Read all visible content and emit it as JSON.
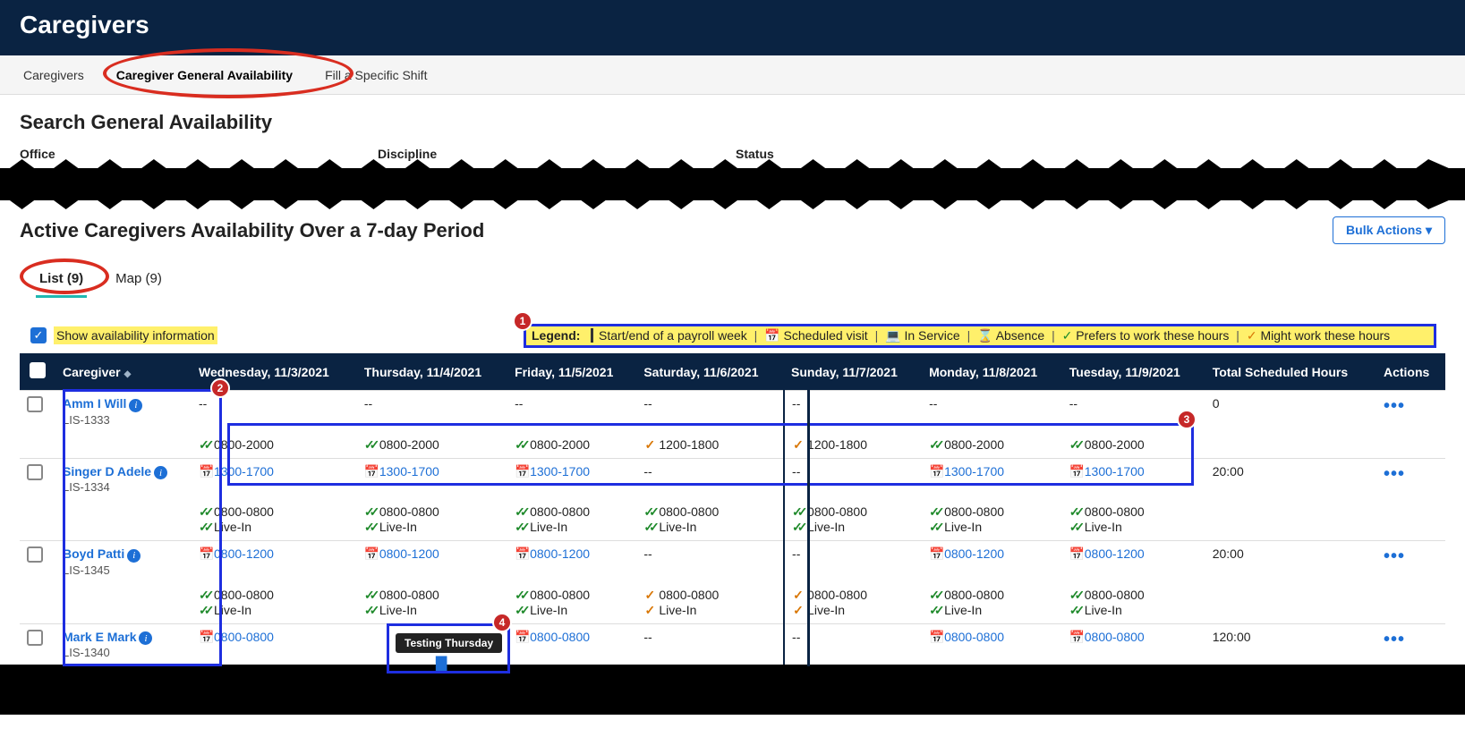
{
  "header": {
    "title": "Caregivers"
  },
  "tabs": {
    "items": [
      "Caregivers",
      "Caregiver General Availability",
      "Fill a Specific Shift"
    ],
    "active_index": 1
  },
  "search": {
    "heading": "Search General Availability",
    "filters": [
      "Office",
      "Discipline",
      "Status"
    ]
  },
  "results": {
    "heading": "Active Caregivers Availability Over a 7-day Period",
    "bulk_label": "Bulk Actions ▾",
    "sub_tabs": {
      "list": "List (9)",
      "map": "Map (9)"
    },
    "show_avail_label": "Show availability information",
    "legend": {
      "label": "Legend:",
      "items": [
        {
          "icon": "|",
          "text": "Start/end of a payroll week"
        },
        {
          "icon": "cal",
          "text": "Scheduled visit"
        },
        {
          "icon": "svc",
          "text": "In Service"
        },
        {
          "icon": "abs",
          "text": "Absence"
        },
        {
          "icon": "pref",
          "text": "Prefers to work these hours"
        },
        {
          "icon": "might",
          "text": "Might work these hours"
        }
      ]
    },
    "columns": {
      "caregiver": "Caregiver",
      "days": [
        "Wednesday, 11/3/2021",
        "Thursday, 11/4/2021",
        "Friday, 11/5/2021",
        "Saturday, 11/6/2021",
        "Sunday, 11/7/2021",
        "Monday, 11/8/2021",
        "Tuesday, 11/9/2021"
      ],
      "total": "Total Scheduled Hours",
      "actions": "Actions"
    },
    "rows": [
      {
        "name": "Amm I Will",
        "id": "LIS-1333",
        "total": "0",
        "sched": [
          "--",
          "--",
          "--",
          "--",
          "--",
          "--",
          "--"
        ]
      },
      {
        "name": "Singer D Adele",
        "id": "LIS-1334",
        "total": "20:00",
        "prefline": [
          {
            "icon": "green",
            "t": "0800-2000"
          },
          {
            "icon": "green",
            "t": "0800-2000"
          },
          {
            "icon": "green",
            "t": "0800-2000"
          },
          {
            "icon": "orange",
            "t": "1200-1800"
          },
          {
            "icon": "orange",
            "t": "1200-1800"
          },
          {
            "icon": "green",
            "t": "0800-2000"
          },
          {
            "icon": "green",
            "t": "0800-2000"
          }
        ],
        "schedline": [
          {
            "icon": "cal",
            "t": "1300-1700"
          },
          {
            "icon": "cal",
            "t": "1300-1700"
          },
          {
            "icon": "cal",
            "t": "1300-1700"
          },
          {
            "t": "--"
          },
          {
            "t": "--"
          },
          {
            "icon": "cal",
            "t": "1300-1700"
          },
          {
            "icon": "cal",
            "t": "1300-1700"
          }
        ],
        "prefline2": [
          {
            "icon": "green",
            "t": "0800-0800"
          },
          {
            "icon": "green",
            "t": "0800-0800"
          },
          {
            "icon": "green",
            "t": "0800-0800"
          },
          {
            "icon": "green",
            "t": "0800-0800"
          },
          {
            "icon": "green",
            "t": "0800-0800"
          },
          {
            "icon": "green",
            "t": "0800-0800"
          },
          {
            "icon": "green",
            "t": "0800-0800"
          }
        ],
        "livein": [
          {
            "icon": "green",
            "t": "Live-In"
          },
          {
            "icon": "green",
            "t": "Live-In"
          },
          {
            "icon": "green",
            "t": "Live-In"
          },
          {
            "icon": "green",
            "t": "Live-In"
          },
          {
            "icon": "green",
            "t": "Live-In"
          },
          {
            "icon": "green",
            "t": "Live-In"
          },
          {
            "icon": "green",
            "t": "Live-In"
          }
        ]
      },
      {
        "name": "Boyd Patti",
        "id": "LIS-1345",
        "total": "20:00",
        "schedline": [
          {
            "icon": "cal",
            "t": "0800-1200"
          },
          {
            "icon": "cal",
            "t": "0800-1200"
          },
          {
            "icon": "cal",
            "t": "0800-1200"
          },
          {
            "t": "--"
          },
          {
            "t": "--"
          },
          {
            "icon": "cal",
            "t": "0800-1200"
          },
          {
            "icon": "cal",
            "t": "0800-1200"
          }
        ],
        "prefline": [
          {
            "icon": "green",
            "t": "0800-0800"
          },
          {
            "icon": "green",
            "t": "0800-0800"
          },
          {
            "icon": "green",
            "t": "0800-0800"
          },
          {
            "icon": "orange",
            "t": "0800-0800"
          },
          {
            "icon": "orange",
            "t": "0800-0800"
          },
          {
            "icon": "green",
            "t": "0800-0800"
          },
          {
            "icon": "green",
            "t": "0800-0800"
          }
        ],
        "livein": [
          {
            "icon": "green",
            "t": "Live-In"
          },
          {
            "icon": "green",
            "t": "Live-In"
          },
          {
            "icon": "green",
            "t": "Live-In"
          },
          {
            "icon": "orange",
            "t": "Live-In"
          },
          {
            "icon": "orange",
            "t": "Live-In"
          },
          {
            "icon": "green",
            "t": "Live-In"
          },
          {
            "icon": "green",
            "t": "Live-In"
          }
        ]
      },
      {
        "name": "Mark E Mark",
        "id": "LIS-1340",
        "total": "120:00",
        "schedline": [
          {
            "icon": "cal",
            "t": "0800-0800"
          },
          {
            "note": true
          },
          {
            "icon": "cal",
            "t": "0800-0800"
          },
          {
            "t": "--"
          },
          {
            "t": "--"
          },
          {
            "icon": "cal",
            "t": "0800-0800"
          },
          {
            "icon": "cal",
            "t": "0800-0800"
          }
        ]
      }
    ],
    "tooltip": "Testing Thursday"
  },
  "annotations": {
    "b1": "1",
    "b2": "2",
    "b3": "3",
    "b4": "4"
  }
}
